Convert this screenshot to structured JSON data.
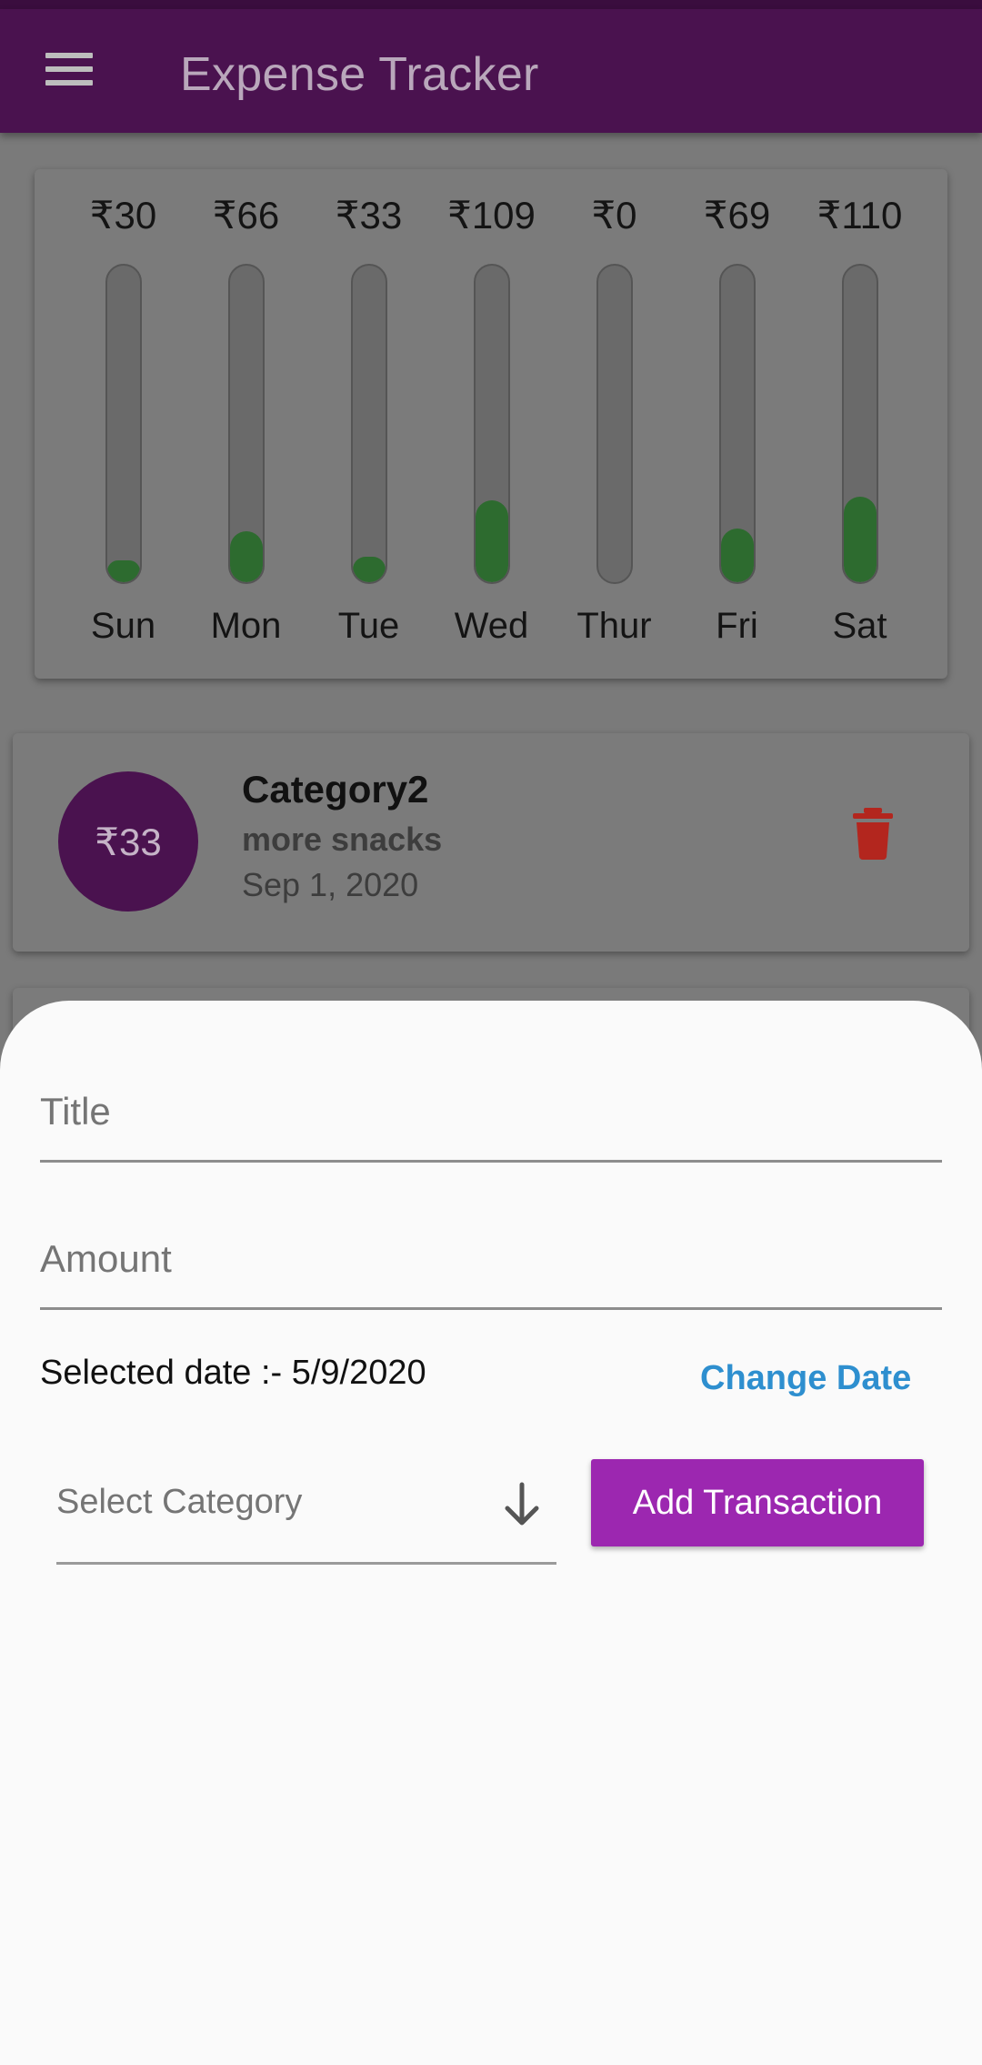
{
  "appbar": {
    "title": "Expense Tracker",
    "menu_icon": "hamburger-menu-icon"
  },
  "chart_data": {
    "type": "bar",
    "currency_symbol": "₹",
    "categories": [
      "Sun",
      "Mon",
      "Tue",
      "Wed",
      "Thur",
      "Fri",
      "Sat"
    ],
    "values": [
      30,
      66,
      33,
      109,
      0,
      69,
      110
    ],
    "labels": [
      "₹30",
      "₹66",
      "₹33",
      "₹109",
      "₹0",
      "₹69",
      "₹110"
    ],
    "fill_fraction": [
      0.07,
      0.16,
      0.08,
      0.26,
      0.0,
      0.17,
      0.27
    ],
    "colors": {
      "fill": "#2d6b2f",
      "track": "#6a6a6a"
    }
  },
  "transaction": {
    "amount": "₹33",
    "title": "Category2",
    "subtitle": "more snacks",
    "date": "Sep 1, 2020",
    "delete_icon": "trash-icon"
  },
  "sheet": {
    "title_placeholder": "Title",
    "amount_placeholder": "Amount",
    "selected_date": "Selected date :- 5/9/2020",
    "change_date_label": "Change Date",
    "category_placeholder": "Select Category",
    "dropdown_icon": "arrow-down-icon",
    "add_button_label": "Add Transaction"
  },
  "colors": {
    "appbar": "#4a124f",
    "accent": "#9c27b0",
    "link": "#2e8fcf",
    "delete": "#b3261e"
  }
}
